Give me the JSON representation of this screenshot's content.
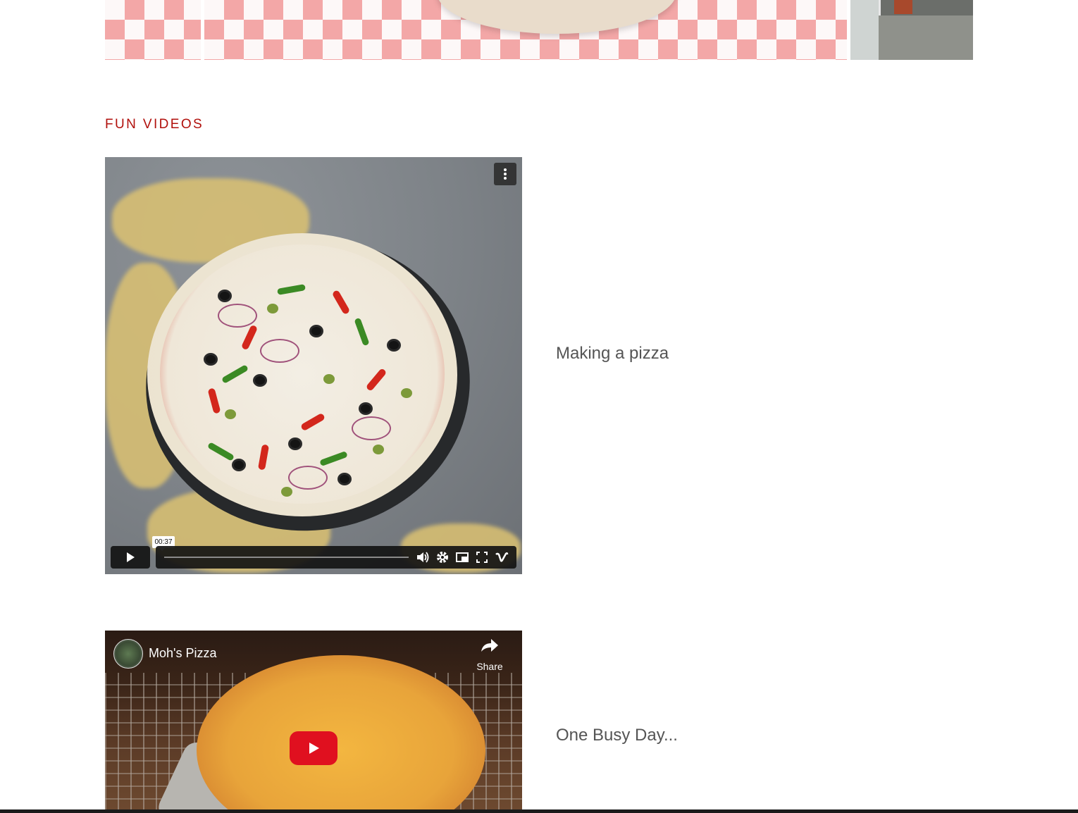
{
  "section": {
    "title": "FUN VIDEOS"
  },
  "videos": [
    {
      "caption": "Making a pizza",
      "player": "vimeo",
      "timecode": "00:37",
      "controls": [
        "play-icon",
        "volume-icon",
        "settings-icon",
        "pip-icon",
        "fullscreen-icon",
        "vimeo-logo-icon"
      ]
    },
    {
      "caption": "One Busy Day...",
      "player": "youtube",
      "channel": "Moh's Pizza",
      "share_label": "Share"
    }
  ],
  "colors": {
    "accent": "#b1100c",
    "caption": "#555555",
    "youtube_red": "#e0101f"
  }
}
